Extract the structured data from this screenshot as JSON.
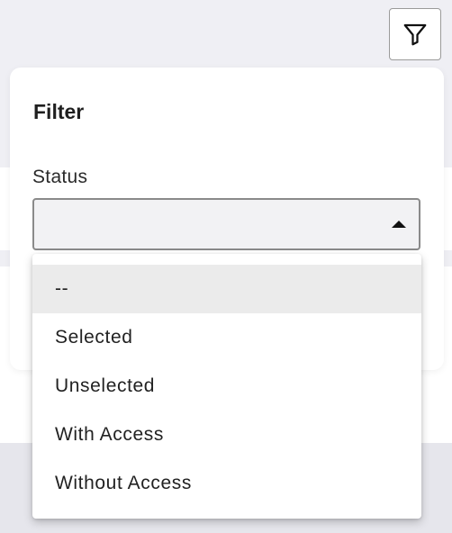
{
  "filter_button": {
    "icon": "filter-icon"
  },
  "panel": {
    "title": "Filter",
    "status_label": "Status",
    "status_value": ""
  },
  "dropdown": {
    "options": [
      {
        "label": "--",
        "highlighted": true
      },
      {
        "label": "Selected",
        "highlighted": false
      },
      {
        "label": "Unselected",
        "highlighted": false
      },
      {
        "label": "With Access",
        "highlighted": false
      },
      {
        "label": "Without Access",
        "highlighted": false
      }
    ]
  }
}
